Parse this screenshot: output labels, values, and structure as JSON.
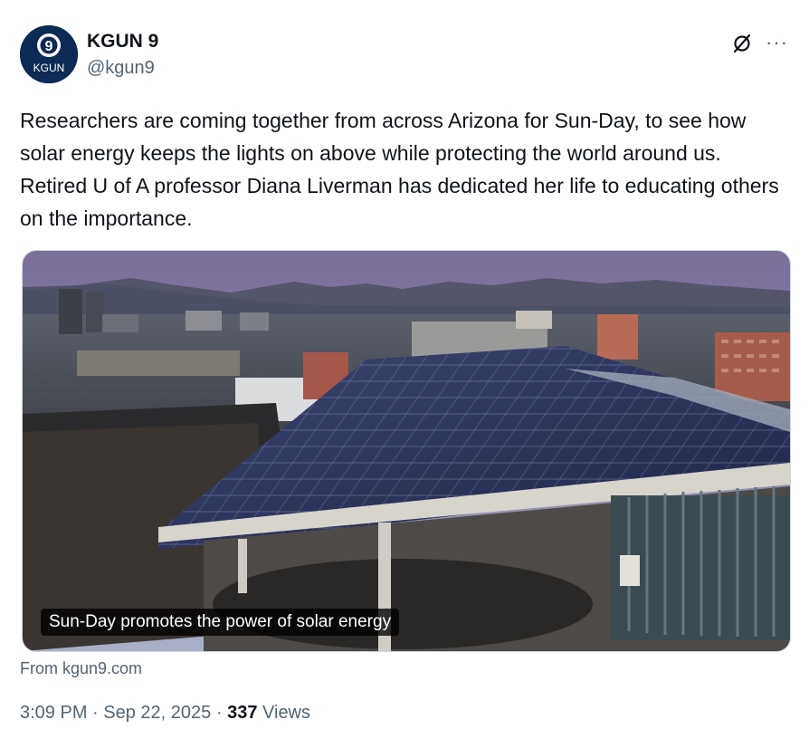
{
  "account": {
    "name": "KGUN 9",
    "handle": "@kgun9",
    "avatar_logo_text": "KGUN",
    "avatar_number": "9"
  },
  "tweet": {
    "text": "Researchers are coming together from across Arizona for Sun-Day, to see how solar energy keeps the lights on above while protecting the world around us. Retired U of A professor Diana Liverman has dedicated her life to educating others on the importance."
  },
  "media": {
    "caption": "Sun-Day promotes the power of solar energy",
    "source": "From kgun9.com"
  },
  "meta": {
    "time": "3:09 PM",
    "separator": "·",
    "date": "Sep 22, 2025",
    "views_count": "337",
    "views_label": "Views"
  },
  "icons": {
    "grok": "grok-icon",
    "more": "more-icon"
  },
  "colors": {
    "avatar_bg": "#0b2a55",
    "text": "#0f1419",
    "secondary": "#536471"
  }
}
